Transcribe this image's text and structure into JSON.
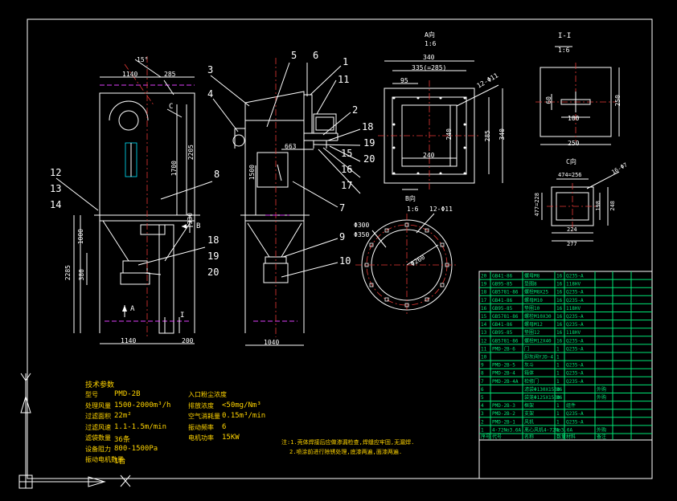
{
  "callouts": {
    "front": [
      "12",
      "13",
      "14",
      "8",
      "18",
      "19",
      "20"
    ],
    "side": [
      "3",
      "4",
      "5",
      "6",
      "1",
      "11",
      "2",
      "18",
      "19",
      "15",
      "20",
      "16",
      "17",
      "7",
      "9",
      "10"
    ]
  },
  "front_view": {
    "d_top": "1140",
    "d_angle": "15°",
    "d_285": "285",
    "d_1700": "1700",
    "d_2205": "2205",
    "d_330": "330",
    "d_1000": "1000",
    "d_2285": "2285",
    "d_380": "380",
    "d_bottom": "1140",
    "d_200": "200",
    "label_c": "C",
    "label_b": "B",
    "label_a": "A",
    "label_i": "I"
  },
  "side_view": {
    "d_663": "663",
    "d_1500": "1500",
    "d_bottom": "1040"
  },
  "view_a": {
    "title": "A向",
    "scale": "1:6",
    "d_340": "340",
    "d_335": "335(=285)",
    "d_95": "95",
    "d_holes": "12-Φ11",
    "d_240a": "240",
    "d_240b": "240",
    "d_285": "285",
    "d_340v": "340"
  },
  "view_11": {
    "title": "I-I",
    "scale": "1:6",
    "d_60": "60",
    "d_100": "100",
    "d_250v": "250",
    "d_250h": "250"
  },
  "view_c": {
    "title": "C向",
    "d_474": "474=256",
    "d_holes": "16-Φ7",
    "d_477": "477=228",
    "d_198": "198",
    "d_248": "248",
    "d_224": "224",
    "d_277": "277"
  },
  "view_b": {
    "title": "B向",
    "scale": "1:6",
    "d_holes": "12-Φ11",
    "d_300": "Φ300",
    "d_350": "Φ350",
    "d_260": "Φ260"
  },
  "specs": {
    "title": "技术参数",
    "left": [
      {
        "k": "型号",
        "v": "PMD-2B"
      },
      {
        "k": "处理风量",
        "v": "1500-2000m³/h"
      },
      {
        "k": "过滤面积",
        "v": "22m²"
      },
      {
        "k": "过滤风速",
        "v": "1.1-1.5m/min"
      },
      {
        "k": "滤袋数量",
        "v": "36条"
      },
      {
        "k": "设备阻力",
        "v": "800-1500Pa"
      },
      {
        "k": "振动电机数量",
        "v": "1台"
      }
    ],
    "right": [
      {
        "k": "入口粉尘浓度",
        "v": ""
      },
      {
        "k": "排放浓度",
        "v": "<50mg/Nm³"
      },
      {
        "k": "空气消耗量",
        "v": "0.15m³/min"
      },
      {
        "k": "振动频率",
        "v": "6"
      },
      {
        "k": "电机功率",
        "v": "15KW"
      }
    ],
    "notes": [
      "注:1.壳体焊接后应做渗漏检查,焊缝应牢固,无漏焊.",
      "2.喷涂前进行除锈处理,底漆两遍,面漆两遍."
    ]
  },
  "bom": {
    "rows": [
      [
        "20",
        "GB41-86",
        "螺母M8",
        "16",
        "Q235-A",
        ""
      ],
      [
        "19",
        "GB95-85",
        "垫圈8",
        "16",
        "118HV",
        ""
      ],
      [
        "18",
        "GB5781-86",
        "螺栓M8X25",
        "16",
        "Q235-A",
        ""
      ],
      [
        "17",
        "GB41-86",
        "螺母M10",
        "16",
        "Q235-A",
        ""
      ],
      [
        "16",
        "GB95-85",
        "垫圈10",
        "16",
        "118HV",
        ""
      ],
      [
        "15",
        "GB5781-86",
        "螺栓M10X30",
        "16",
        "Q235-A",
        ""
      ],
      [
        "14",
        "GB41-86",
        "螺母M12",
        "16",
        "Q235-A",
        ""
      ],
      [
        "13",
        "GB95-85",
        "垫圈12",
        "16",
        "118HV",
        ""
      ],
      [
        "12",
        "GB5781-86",
        "螺栓M12X40",
        "16",
        "Q235-A",
        ""
      ],
      [
        "11",
        "PMD-2B-6",
        "门",
        "1",
        "Q235-A",
        ""
      ],
      [
        "10",
        "",
        "卸灰阀YJD-4",
        "1",
        "",
        ""
      ],
      [
        "9",
        "PMD-2B-5",
        "灰斗",
        "1",
        "Q235-A",
        ""
      ],
      [
        "8",
        "PMD-2B-4",
        "箱体",
        "1",
        "Q235-A",
        ""
      ],
      [
        "7",
        "PMD-2B-4A",
        "检修门",
        "1",
        "Q235-A",
        ""
      ],
      [
        "6",
        "",
        "滤袋Φ130X1500",
        "36",
        "",
        "外购"
      ],
      [
        "5",
        "",
        "袋笼Φ125X1500",
        "36",
        "",
        "外购"
      ],
      [
        "4",
        "PMD-2B-3",
        "框架",
        "1",
        "组件",
        ""
      ],
      [
        "3",
        "PMD-2B-2",
        "支架",
        "1",
        "Q235-A",
        ""
      ],
      [
        "2",
        "PMD-2B-1",
        "风机",
        "1",
        "Q235-A",
        ""
      ],
      [
        "1",
        "4-72No3.6A",
        "离心风机4-72No3.6A",
        "1",
        "",
        "外购"
      ]
    ],
    "header": [
      "序号",
      "代号",
      "名称",
      "数量",
      "材料",
      "备注"
    ]
  }
}
